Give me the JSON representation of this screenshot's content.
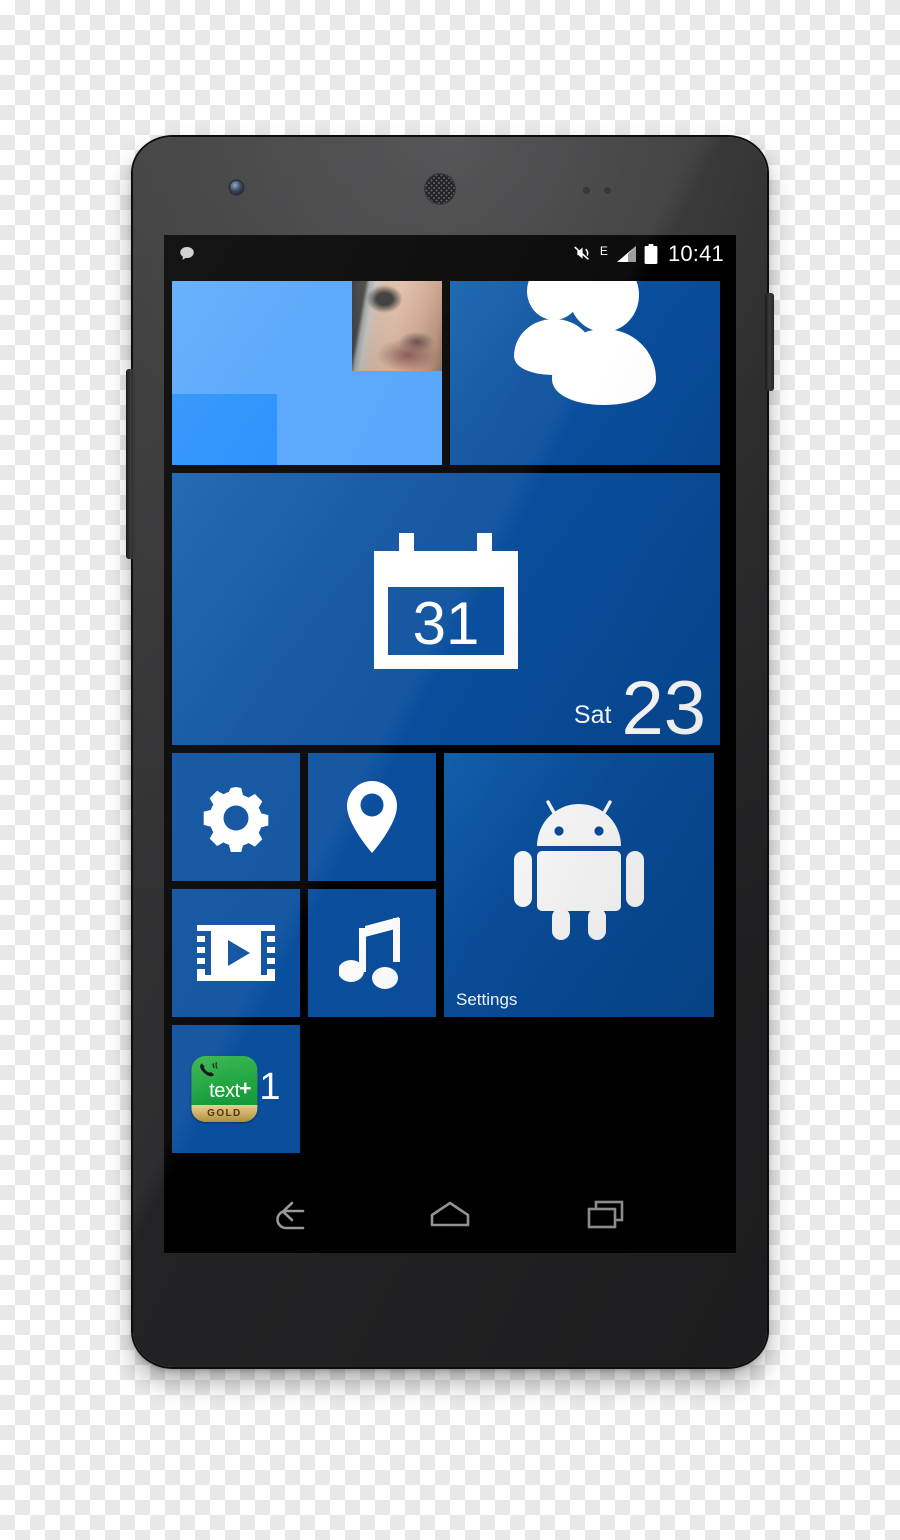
{
  "device": {
    "name": "Android smartphone",
    "hardware": {
      "front_camera": "front-camera",
      "earpiece": "earpiece-speaker",
      "proximity_sensor": "proximity-sensor",
      "light_sensor": "light-sensor",
      "volume_rocker": "volume-rocker",
      "power_button": "power-button"
    }
  },
  "status_bar": {
    "notification_icon": "speech-bubble-icon",
    "mute_icon": "volume-mute-icon",
    "network_type": "E",
    "signal_icon": "signal-bars-icon",
    "battery_icon": "battery-full-icon",
    "clock": "10:41"
  },
  "home_screen": {
    "theme_accent": "#0a4f9e",
    "background": "#000000",
    "tiles": [
      {
        "id": "people-live",
        "name": "people-live-tile",
        "label": "",
        "icon": "contact-photo-mosaic",
        "size": "medium",
        "color": "#4fa3fb"
      },
      {
        "id": "people",
        "name": "people-tile",
        "label": "",
        "icon": "people-icon",
        "size": "medium",
        "color": "#0a4f9e"
      },
      {
        "id": "calendar",
        "name": "calendar-tile",
        "label": "",
        "icon": "calendar-icon",
        "icon_day": "31",
        "day_of_week": "Sat",
        "day_number": "23",
        "size": "wide",
        "color": "#0a4f9e"
      },
      {
        "id": "settings-small",
        "name": "settings-tile",
        "label": "",
        "icon": "gear-icon",
        "size": "small",
        "color": "#0a4f9e"
      },
      {
        "id": "maps",
        "name": "maps-tile",
        "label": "",
        "icon": "location-pin-icon",
        "size": "small",
        "color": "#0a4f9e"
      },
      {
        "id": "video",
        "name": "video-tile",
        "label": "",
        "icon": "film-play-icon",
        "size": "small",
        "color": "#0a4f9e"
      },
      {
        "id": "music",
        "name": "music-tile",
        "label": "",
        "icon": "music-note-icon",
        "size": "small",
        "color": "#0a4f9e"
      },
      {
        "id": "android-settings",
        "name": "android-settings-tile",
        "label": "Settings",
        "icon": "android-robot-icon",
        "size": "medium",
        "color": "#0a4f9e"
      },
      {
        "id": "textplus",
        "name": "textplus-gold-tile",
        "label": "",
        "icon": "textplus-gold-icon",
        "icon_text": "text",
        "icon_plus": "+",
        "icon_tier": "GOLD",
        "badge_count": "1",
        "size": "small",
        "color": "#0a4f9e"
      }
    ]
  },
  "nav_bar": {
    "buttons": [
      {
        "name": "back-button",
        "icon": "back-arrow-icon",
        "label": "Back"
      },
      {
        "name": "home-button",
        "icon": "home-icon",
        "label": "Home"
      },
      {
        "name": "recents-button",
        "icon": "recents-icon",
        "label": "Recent apps"
      }
    ]
  }
}
